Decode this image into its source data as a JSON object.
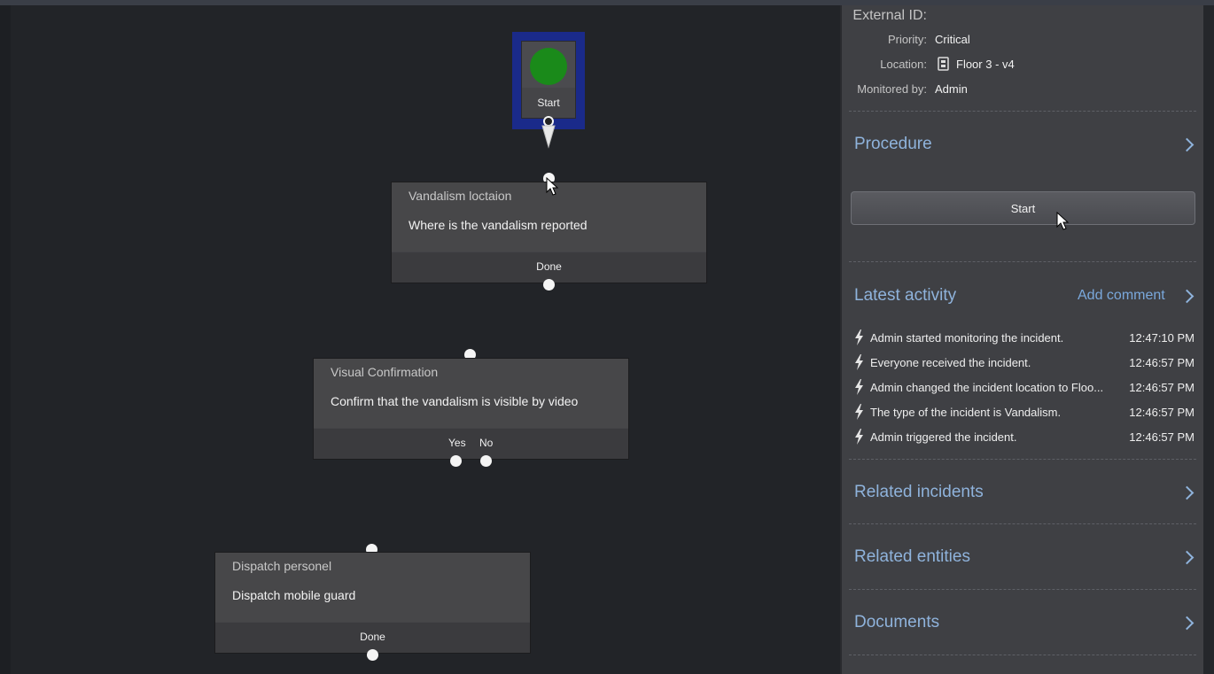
{
  "flow": {
    "start_label": "Start",
    "nodes": [
      {
        "title": "Vandalism loctaion",
        "text": "Where is the vandalism reported",
        "outputs": [
          "Done"
        ]
      },
      {
        "title": "Visual Confirmation",
        "text": "Confirm that the vandalism is visible by video",
        "outputs": [
          "Yes",
          "No"
        ]
      },
      {
        "title": "Dispatch personel",
        "text": "Dispatch mobile guard",
        "outputs": [
          "Done"
        ]
      }
    ]
  },
  "panel": {
    "meta": {
      "external_id_label": "External ID:",
      "priority_label": "Priority:",
      "priority_value": "Critical",
      "location_label": "Location:",
      "location_value": "Floor 3 - v4",
      "location_icon": "floor-map-icon",
      "monitored_label": "Monitored by:",
      "monitored_value": "Admin"
    },
    "procedure": {
      "title": "Procedure",
      "start_button": "Start"
    },
    "activity": {
      "title": "Latest activity",
      "add_comment": "Add comment",
      "items": [
        {
          "text": "Admin started monitoring the incident.",
          "time": "12:47:10 PM"
        },
        {
          "text": "Everyone received the incident.",
          "time": "12:46:57 PM"
        },
        {
          "text": "Admin changed the incident location to Floo...",
          "time": "12:46:57 PM"
        },
        {
          "text": "The type of the incident is Vandalism.",
          "time": "12:46:57 PM"
        },
        {
          "text": "Admin triggered the incident.",
          "time": "12:46:57 PM"
        }
      ]
    },
    "sections": [
      {
        "title": "Related incidents"
      },
      {
        "title": "Related entities"
      },
      {
        "title": "Documents"
      }
    ]
  },
  "colors": {
    "accent_link": "#8fb3dc",
    "start_green": "#1a8a1a",
    "selection_blue": "#1a2a8a",
    "canvas_bg": "#222428",
    "panel_bg": "#3f4044"
  }
}
